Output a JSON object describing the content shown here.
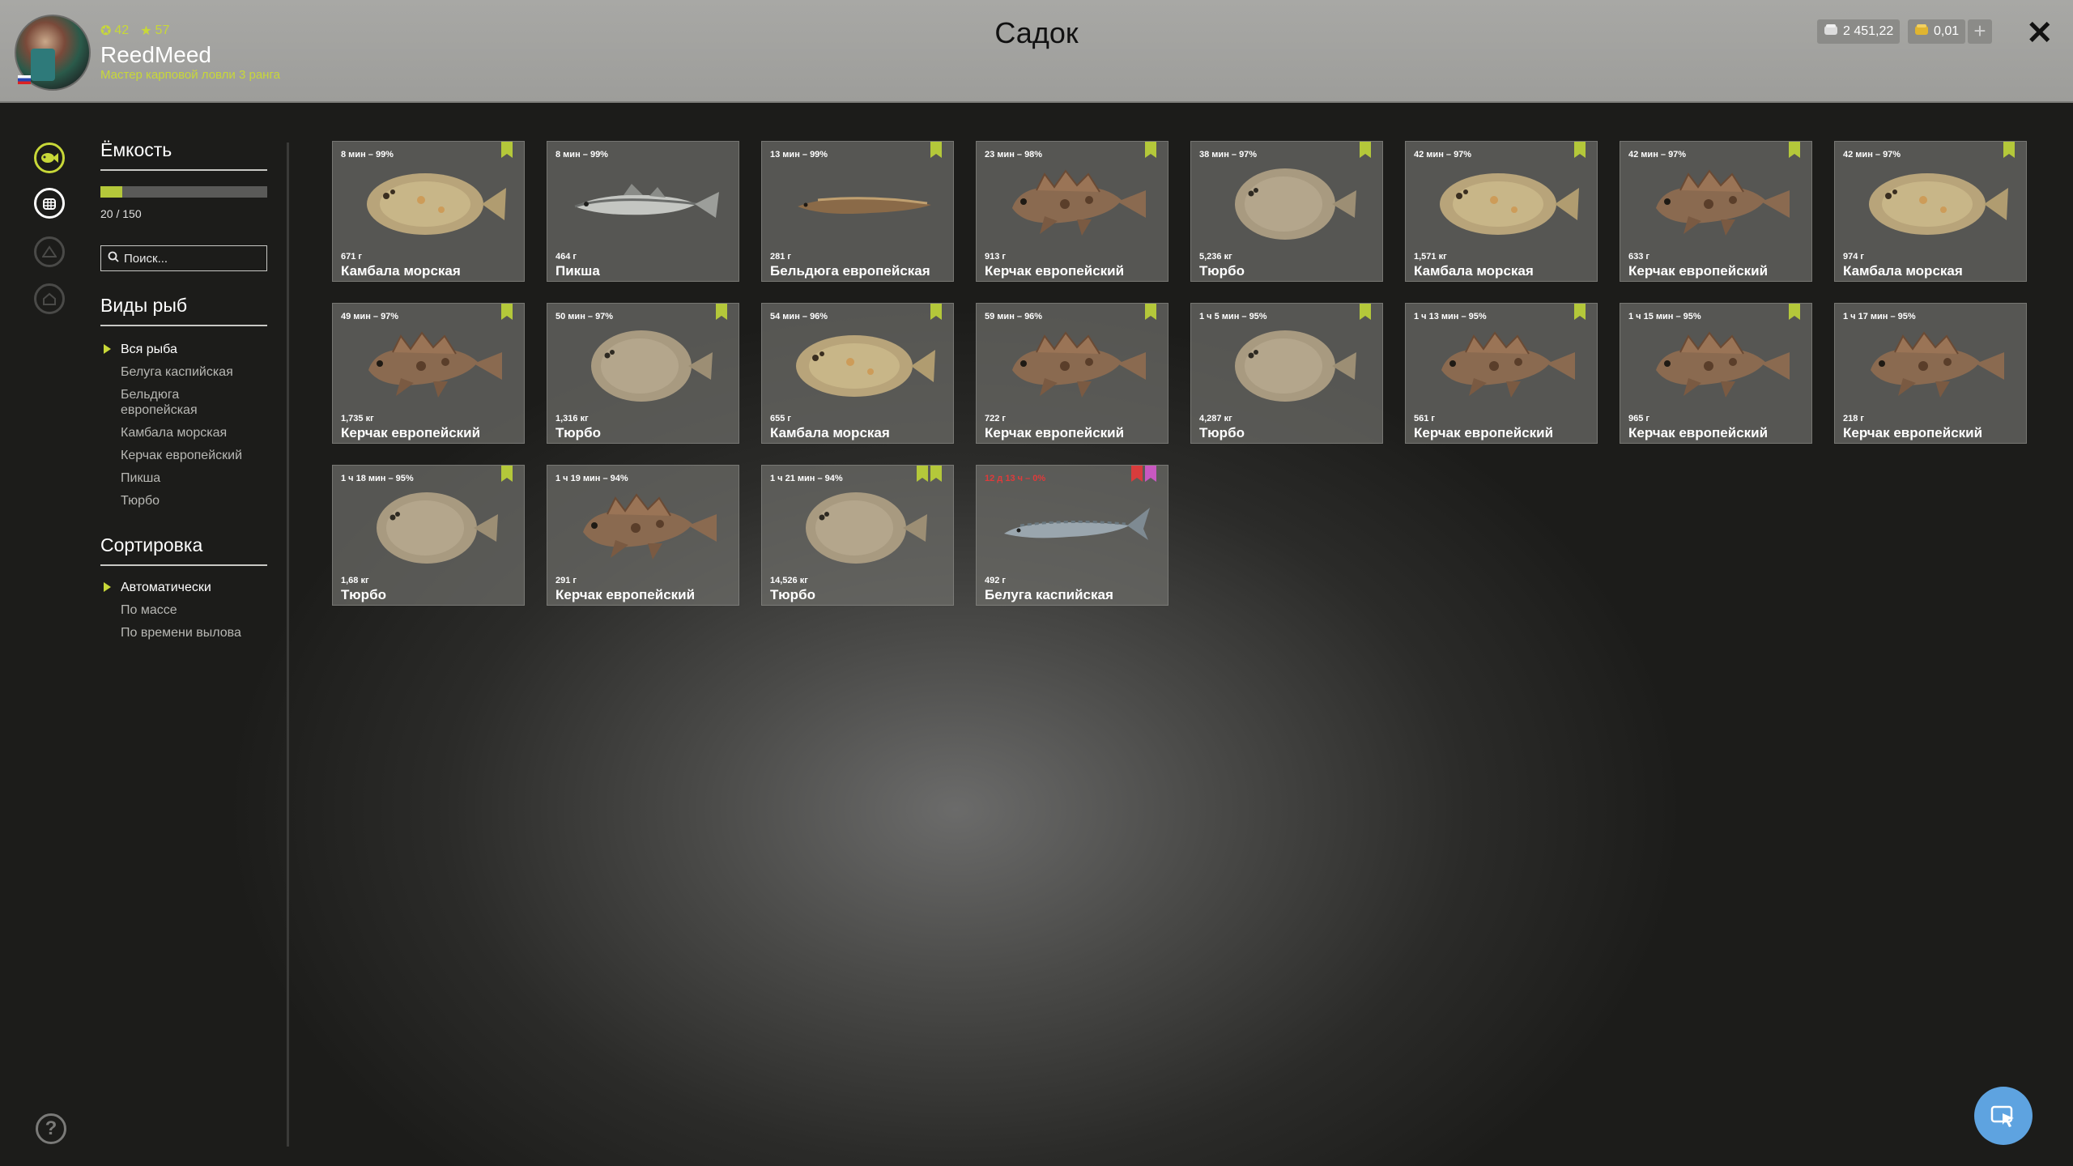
{
  "header": {
    "title": "Садок",
    "user": {
      "level_a": "42",
      "level_b": "57",
      "name": "ReedMeed",
      "subtitle": "Мастер карповой ловли 3 ранга"
    },
    "currency": {
      "silver": "2 451,22",
      "gold": "0,01",
      "add": "+"
    },
    "close": "✕"
  },
  "sidebar": {
    "capacity": {
      "title": "Ёмкость",
      "text": "20 / 150",
      "fill_fraction": 0.133
    },
    "search_placeholder": "Поиск...",
    "species": {
      "title": "Виды рыб",
      "items": [
        "Вся рыба",
        "Белуга каспийская",
        "Бельдюга европейская",
        "Камбала морская",
        "Керчак европейский",
        "Пикша",
        "Тюрбо"
      ]
    },
    "sort": {
      "title": "Сортировка",
      "items": [
        "Автоматически",
        "По массе",
        "По времени вылова"
      ]
    }
  },
  "cards": [
    {
      "time": "8 мин – 99%",
      "weight": "671 г",
      "name": "Камбала морская",
      "kind": "flounder",
      "badges": [
        "green"
      ]
    },
    {
      "time": "8 мин – 99%",
      "weight": "464 г",
      "name": "Пикша",
      "kind": "haddock",
      "badges": []
    },
    {
      "time": "13 мин – 99%",
      "weight": "281 г",
      "name": "Бельдюга европейская",
      "kind": "eelpout",
      "badges": [
        "green"
      ]
    },
    {
      "time": "23 мин – 98%",
      "weight": "913 г",
      "name": "Керчак европейский",
      "kind": "sculpin",
      "badges": [
        "green"
      ]
    },
    {
      "time": "38 мин – 97%",
      "weight": "5,236 кг",
      "name": "Тюрбо",
      "kind": "turbot",
      "badges": [
        "green"
      ]
    },
    {
      "time": "42 мин – 97%",
      "weight": "1,571 кг",
      "name": "Камбала морская",
      "kind": "flounder",
      "badges": [
        "green"
      ]
    },
    {
      "time": "42 мин – 97%",
      "weight": "633 г",
      "name": "Керчак европейский",
      "kind": "sculpin",
      "badges": [
        "green"
      ]
    },
    {
      "time": "42 мин – 97%",
      "weight": "974 г",
      "name": "Камбала морская",
      "kind": "flounder",
      "badges": [
        "green"
      ]
    },
    {
      "time": "49 мин – 97%",
      "weight": "1,735 кг",
      "name": "Керчак европейский",
      "kind": "sculpin",
      "badges": [
        "green"
      ]
    },
    {
      "time": "50 мин – 97%",
      "weight": "1,316 кг",
      "name": "Тюрбо",
      "kind": "turbot",
      "badges": [
        "green"
      ]
    },
    {
      "time": "54 мин – 96%",
      "weight": "655 г",
      "name": "Камбала морская",
      "kind": "flounder",
      "badges": [
        "green"
      ]
    },
    {
      "time": "59 мин – 96%",
      "weight": "722 г",
      "name": "Керчак европейский",
      "kind": "sculpin",
      "badges": [
        "green"
      ]
    },
    {
      "time": "1 ч 5 мин – 95%",
      "weight": "4,287 кг",
      "name": "Тюрбо",
      "kind": "turbot",
      "badges": [
        "green"
      ]
    },
    {
      "time": "1 ч 13 мин – 95%",
      "weight": "561 г",
      "name": "Керчак европейский",
      "kind": "sculpin",
      "badges": [
        "green"
      ]
    },
    {
      "time": "1 ч 15 мин – 95%",
      "weight": "965 г",
      "name": "Керчак европейский",
      "kind": "sculpin",
      "badges": [
        "green"
      ]
    },
    {
      "time": "1 ч 17 мин – 95%",
      "weight": "218 г",
      "name": "Керчак европейский",
      "kind": "sculpin",
      "badges": []
    },
    {
      "time": "1 ч 18 мин – 95%",
      "weight": "1,68 кг",
      "name": "Тюрбо",
      "kind": "turbot",
      "badges": [
        "green"
      ]
    },
    {
      "time": "1 ч 19 мин – 94%",
      "weight": "291 г",
      "name": "Керчак европейский",
      "kind": "sculpin",
      "badges": []
    },
    {
      "time": "1 ч 21 мин – 94%",
      "weight": "14,526 кг",
      "name": "Тюрбо",
      "kind": "turbot",
      "badges": [
        "green",
        "green"
      ]
    },
    {
      "time": "12 д 13 ч – 0%",
      "weight": "492 г",
      "name": "Белуга каспийская",
      "kind": "sturgeon",
      "badges": [
        "red",
        "pink"
      ],
      "warn": true
    }
  ],
  "colors": {
    "accent": "#c8d838",
    "badge_green": "#b4c83a",
    "badge_red": "#d83c3c",
    "badge_pink": "#c858c0",
    "fab": "#5ea3e0"
  }
}
